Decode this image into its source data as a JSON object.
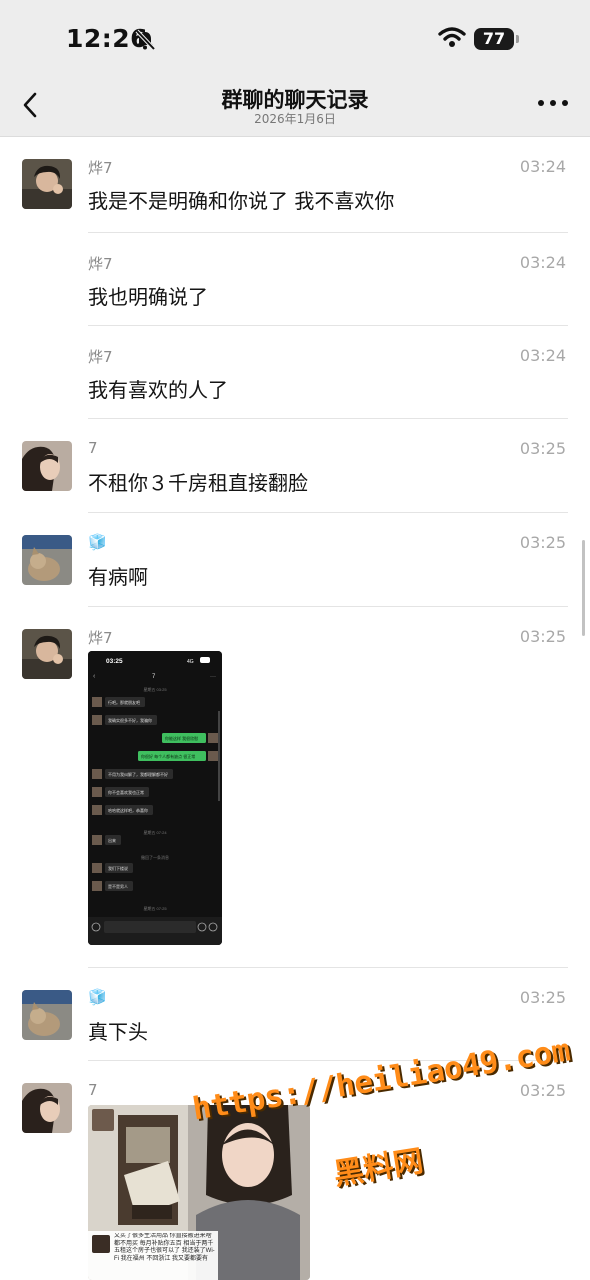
{
  "status_bar": {
    "time": "12:26",
    "battery": "77",
    "icons": [
      "bell-slash-icon",
      "wifi-icon",
      "battery-icon"
    ]
  },
  "header": {
    "title": "群聊的聊天记录",
    "subtitle": "2026年1月6日",
    "back_icon": "chevron-left-icon",
    "more_icon": "more-dots-icon"
  },
  "messages": [
    {
      "sender": "烨7",
      "time": "03:24",
      "text": "我是不是明确和你说了 我不喜欢你"
    },
    {
      "sender": "烨7",
      "time": "03:24",
      "text": "我也明确说了"
    },
    {
      "sender": "烨7",
      "time": "03:24",
      "text": "我有喜欢的人了"
    },
    {
      "sender": "7",
      "time": "03:25",
      "text": "不租你３千房租直接翻脸"
    },
    {
      "sender": "🧊",
      "time": "03:25",
      "text": "有病啊"
    },
    {
      "sender": "烨7",
      "time": "03:25",
      "text": ""
    },
    {
      "sender": "🧊",
      "time": "03:25",
      "text": "真下头"
    },
    {
      "sender": "7",
      "time": "03:25",
      "text": ""
    }
  ],
  "screenshot_image": {
    "time": "03:25",
    "signal": "4G",
    "chat_title": "7",
    "timestamps": [
      "星期五 03:25",
      "星期五 07:24",
      "星期五 07:25"
    ],
    "notice": "撤回了一条消息",
    "lines": [
      {
        "side": "left",
        "text": "行吧。那就朋友吧"
      },
      {
        "side": "left",
        "text": "我确实很多不好，我骗你"
      },
      {
        "side": "right",
        "text": "你能这样 我很欣慰"
      },
      {
        "side": "right",
        "text": "你很好 每个人都有缺点 很正常"
      },
      {
        "side": "left",
        "text": "不用为我纠解了，我都理解都不好"
      },
      {
        "side": "left",
        "text": "你不会喜欢我也正常"
      },
      {
        "side": "left",
        "text": "哈哈就这样吧，恭喜你"
      },
      {
        "side": "left",
        "text": "出来"
      },
      {
        "side": "left",
        "text": "我们下楼说"
      },
      {
        "side": "left",
        "text": "是不是男人"
      }
    ]
  },
  "photo_image": {
    "caption": "又买了很多生活用品 你直接搬进来啥都不用买 每月补贴你五百 相当于两千五租这个房子也很可以了 我还装了Wi-Fi 我在福州 不回浙江 我又要都要有"
  },
  "watermark": {
    "url": "https://heiliao49.com",
    "name": "黑料网"
  }
}
